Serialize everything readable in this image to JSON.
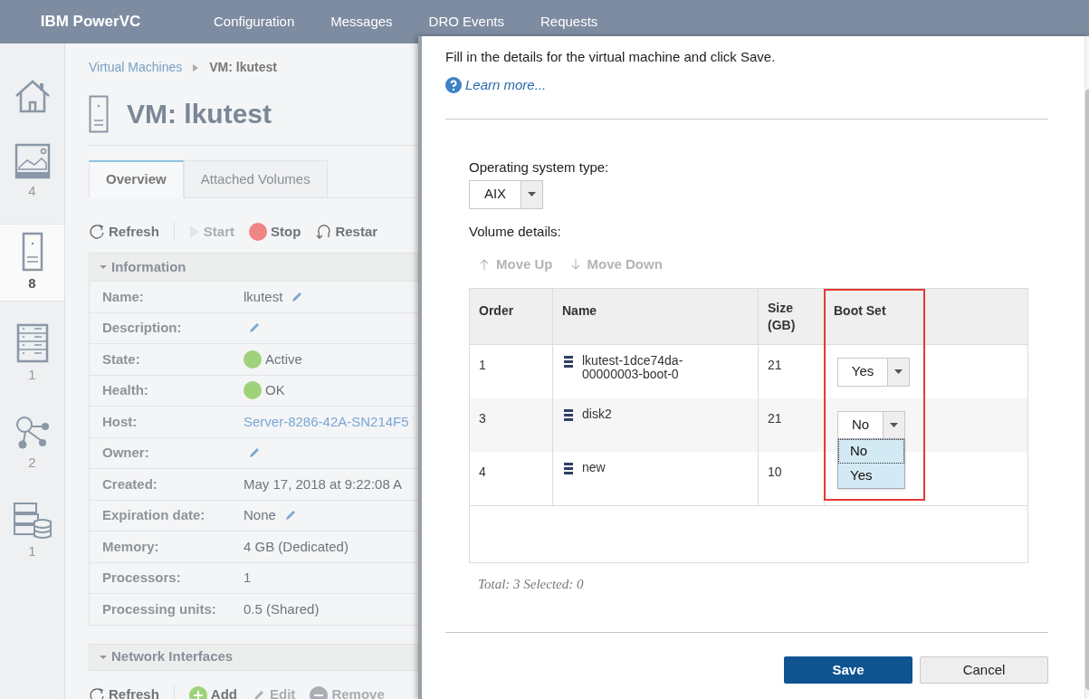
{
  "nav": {
    "brand": "IBM PowerVC",
    "items": [
      "Configuration",
      "Messages",
      "DRO Events",
      "Requests"
    ]
  },
  "rail": [
    {
      "kind": "home",
      "selected": false
    },
    {
      "kind": "image",
      "count": "4",
      "selected": false
    },
    {
      "kind": "vm",
      "count": "8",
      "selected": true
    },
    {
      "kind": "host",
      "count": "1",
      "selected": false
    },
    {
      "kind": "network",
      "count": "2",
      "selected": false
    },
    {
      "kind": "storage",
      "count": "1",
      "selected": false
    }
  ],
  "breadcrumb": {
    "link": "Virtual Machines",
    "current": "VM: lkutest"
  },
  "title": "VM: lkutest",
  "tabs": [
    {
      "label": "Overview",
      "selected": true
    },
    {
      "label": "Attached Volumes",
      "selected": false
    }
  ],
  "toolbar": [
    {
      "kind": "refresh",
      "label": "Refresh",
      "disabled": false
    },
    {
      "kind": "start",
      "label": "Start",
      "disabled": true
    },
    {
      "kind": "stop",
      "label": "Stop",
      "disabled": false
    },
    {
      "kind": "restart",
      "label": "Restar",
      "disabled": false
    }
  ],
  "information": {
    "title": "Information",
    "expanded": true,
    "rows": [
      {
        "label": "Name:",
        "kind": "text",
        "value": "lkutest",
        "editable": true
      },
      {
        "label": "Description:",
        "kind": "text",
        "editable": true
      },
      {
        "label": "State:",
        "kind": "status",
        "value": "Active",
        "color": "#9fd27a"
      },
      {
        "label": "Health:",
        "kind": "status",
        "value": "OK",
        "color": "#9fd27a"
      },
      {
        "label": "Host:",
        "kind": "link",
        "value": "Server-8286-42A-SN214F5"
      },
      {
        "label": "Owner:",
        "kind": "text",
        "editable": true
      },
      {
        "label": "Created:",
        "kind": "text",
        "value": "May 17, 2018 at 9:22:08 A"
      },
      {
        "label": "Expiration date:",
        "kind": "text",
        "value": "None",
        "editable": true
      },
      {
        "label": "Memory:",
        "kind": "text",
        "value": "4 GB (Dedicated)"
      },
      {
        "label": "Processors:",
        "kind": "text",
        "value": "1"
      },
      {
        "label": "Processing units:",
        "kind": "text",
        "value": "0.5 (Shared)"
      }
    ]
  },
  "network": {
    "title": "Network Interfaces",
    "expanded": true,
    "toolbar": [
      {
        "kind": "refresh",
        "label": "Refresh",
        "disabled": false
      },
      {
        "kind": "add",
        "label": "Add",
        "disabled": false
      },
      {
        "kind": "edit",
        "label": "Edit",
        "disabled": true
      },
      {
        "kind": "remove",
        "label": "Remove",
        "disabled": true
      }
    ]
  },
  "dialog": {
    "intro": "Fill in the details for the virtual machine and click Save.",
    "learn_more": "Learn more...",
    "os_type": {
      "label": "Operating system type:",
      "value": "AIX"
    },
    "volume_label": "Volume details:",
    "actions": [
      {
        "kind": "up",
        "label": "Move Up",
        "disabled": true
      },
      {
        "kind": "down",
        "label": "Move Down",
        "disabled": true
      }
    ],
    "table": {
      "columns": [
        "Order",
        "Name",
        "Size (GB)",
        "Boot Set"
      ],
      "annotation": {
        "kind": "highlight-box"
      },
      "rows": [
        {
          "order": "1",
          "name": "lkutest-1dce74da-00000003-boot-0",
          "size": "21",
          "boot_set": "Yes"
        },
        {
          "order": "3",
          "name": "disk2",
          "size": "21",
          "boot_set": "No",
          "dropdown_open": true,
          "options": [
            {
              "label": "No",
              "selected": true
            },
            {
              "label": "Yes",
              "selected": false
            }
          ]
        },
        {
          "order": "4",
          "name": "new",
          "size": "10"
        }
      ]
    },
    "summary": "Total: 3 Selected: 0",
    "buttons": [
      {
        "kind": "primary",
        "label": "Save"
      },
      {
        "kind": "secondary",
        "label": "Cancel"
      }
    ]
  }
}
